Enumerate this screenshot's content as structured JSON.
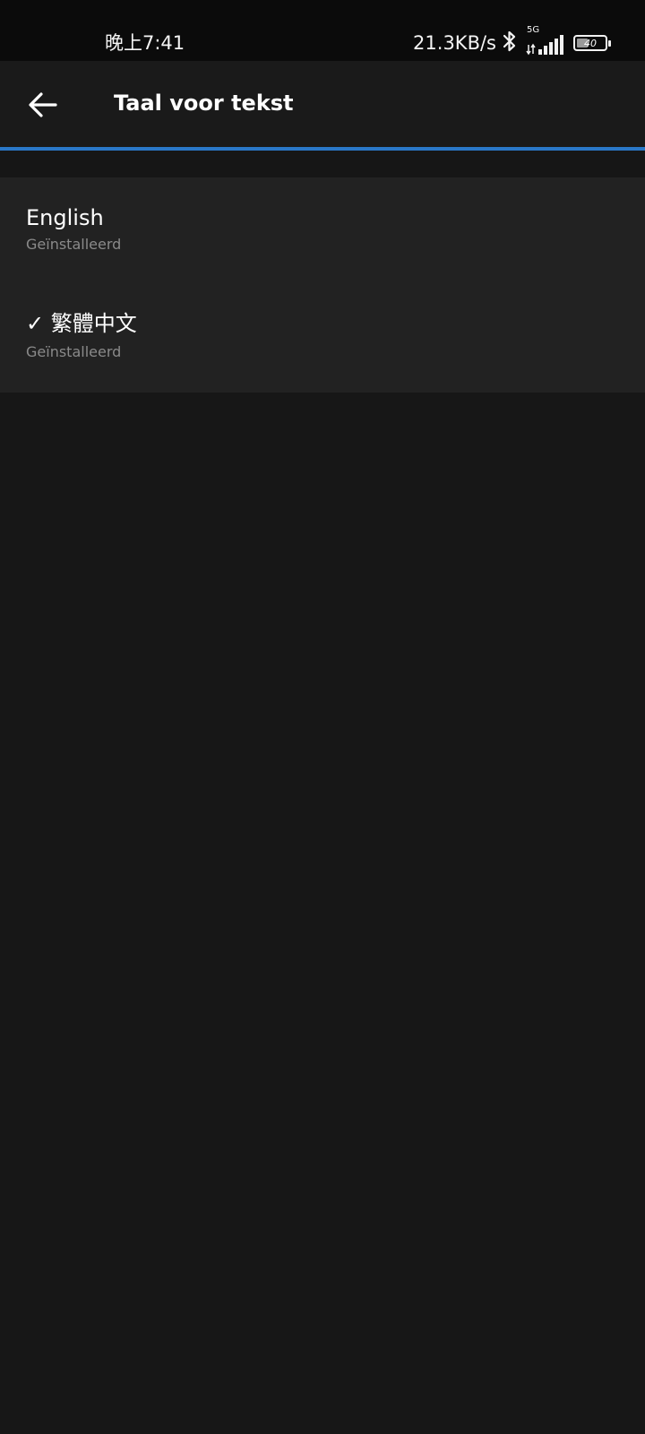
{
  "status_bar": {
    "time": "晚上7:41",
    "net_speed": "21.3KB/s",
    "network_type": "5G",
    "battery_level": "40",
    "icons": [
      "bluetooth-icon",
      "signal-icon",
      "battery-icon"
    ]
  },
  "app_bar": {
    "back_icon": "arrow-left-icon",
    "title": "Taal voor tekst"
  },
  "languages": [
    {
      "name": "English",
      "status": "Geïnstalleerd",
      "selected": false
    },
    {
      "name": "✓ 繁體中文",
      "status": "Geïnstalleerd",
      "selected": true
    }
  ],
  "colors": {
    "accent": "#2a78c8",
    "background": "#161616",
    "list_background": "#222222",
    "secondary_text": "#8a8a8a"
  }
}
